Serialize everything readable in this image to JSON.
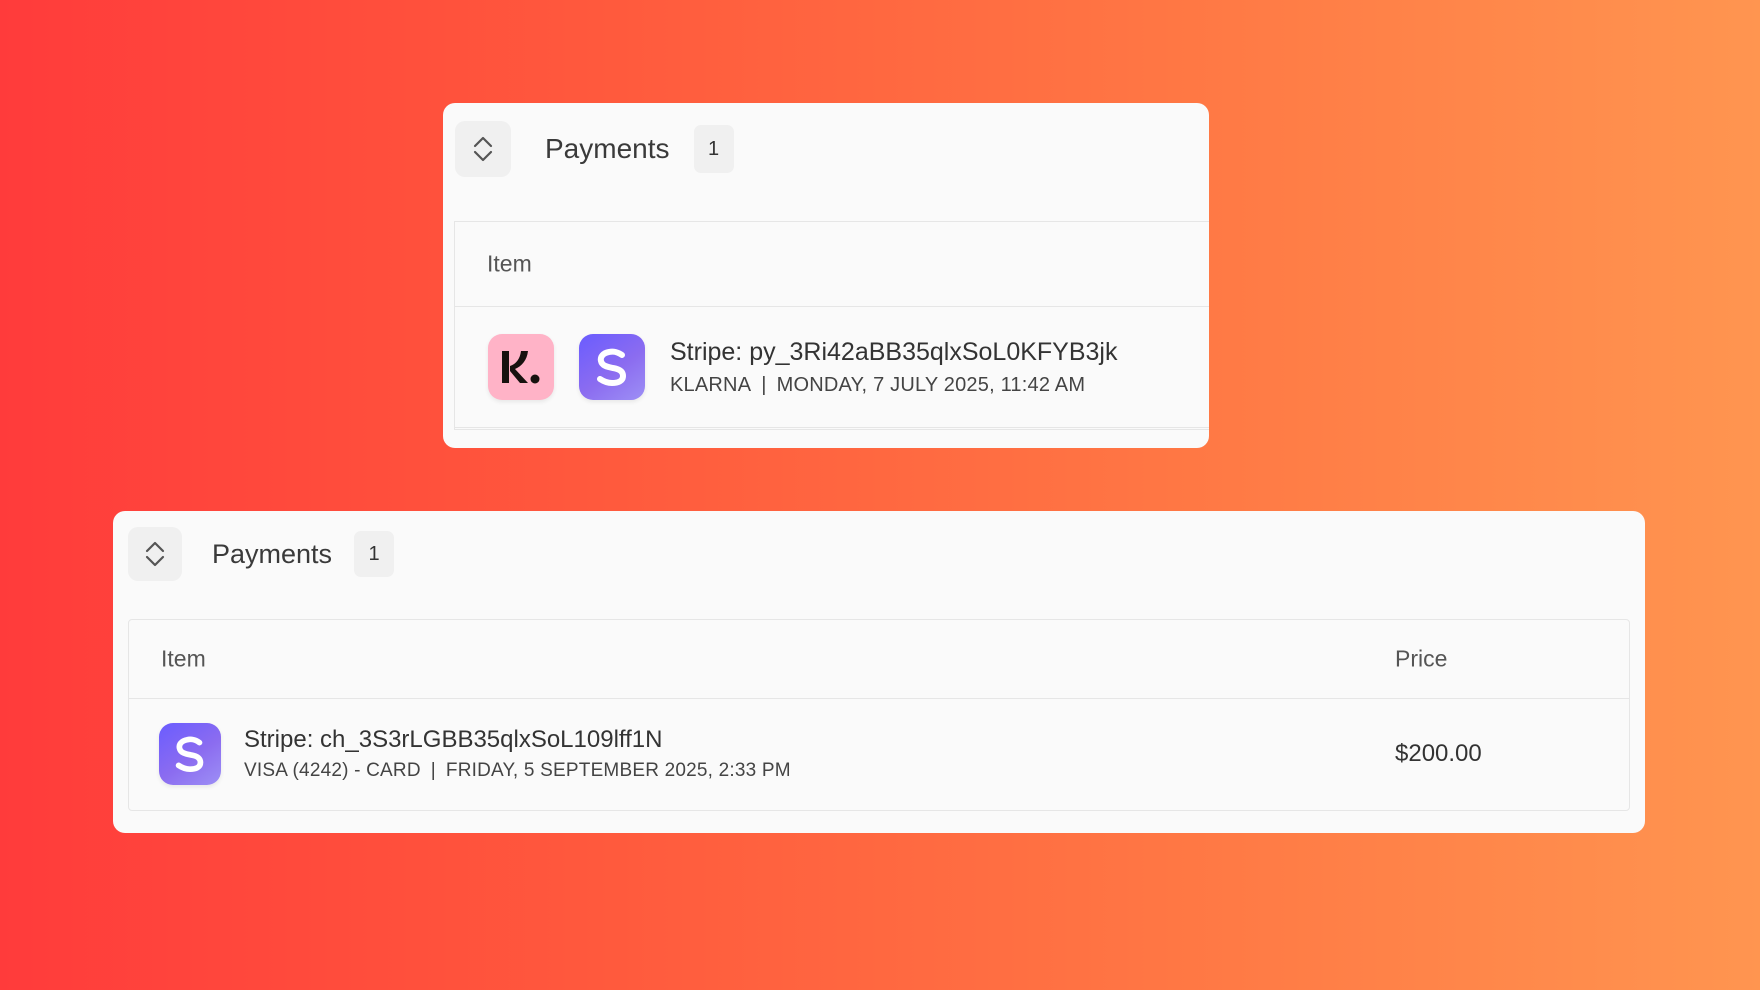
{
  "panel_top": {
    "title": "Payments",
    "count": "1",
    "columns": {
      "item": "Item"
    },
    "row": {
      "title": "Stripe: py_3Ri42aBB35qlxSoL0KFYB3jk",
      "method": "KLARNA",
      "separator": "|",
      "date": "MONDAY, 7 JULY 2025, 11:42 AM",
      "icons": [
        "klarna-logo-icon",
        "stripe-logo-icon"
      ]
    }
  },
  "panel_bottom": {
    "title": "Payments",
    "count": "1",
    "columns": {
      "item": "Item",
      "price": "Price"
    },
    "row": {
      "title": "Stripe: ch_3S3rLGBB35qlxSoL109lff1N",
      "method": "VISA (4242) - CARD",
      "separator": "|",
      "date": "FRIDAY, 5 SEPTEMBER 2025, 2:33 PM",
      "price": "$200.00",
      "icons": [
        "stripe-logo-icon"
      ]
    }
  },
  "colors": {
    "background_start": "#ff3b3b",
    "background_end": "#ff9550",
    "card": "#fafafa",
    "klarna_pink": "#ffb3c7",
    "stripe_purple": "#6a5cff"
  }
}
